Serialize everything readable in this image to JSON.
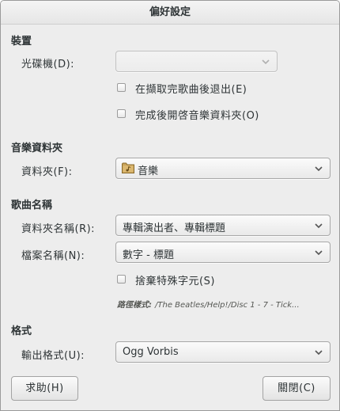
{
  "window": {
    "title": "偏好設定"
  },
  "device": {
    "section_title": "裝置",
    "cd_drive_label": "光碟機(D):",
    "cd_drive_value": "",
    "eject_label": "在擷取完歌曲後退出(E)",
    "open_folder_label": "完成後開啓音樂資料夾(O)"
  },
  "music_folder": {
    "section_title": "音樂資料夾",
    "folder_label": "資料夾(F):",
    "folder_value": "音樂",
    "folder_icon": "folder-music-icon"
  },
  "track_names": {
    "section_title": "歌曲名稱",
    "folder_name_label": "資料夾名稱(R):",
    "folder_name_value": "專輯演出者、專輯標題",
    "file_name_label": "檔案名稱(N):",
    "file_name_value": "數字 - 標題",
    "strip_chars_label": "捨棄特殊字元(S)",
    "path_prefix": "路徑樣式:",
    "path_example": "/The Beatles/Help!/Disc 1 - 7 - Tick..."
  },
  "format": {
    "section_title": "格式",
    "output_label": "輸出格式(U):",
    "output_value": "Ogg Vorbis"
  },
  "buttons": {
    "help": "求助(H)",
    "close": "關閉(C)"
  },
  "colors": {
    "window_bg": "#ededed",
    "text": "#2e3436"
  }
}
